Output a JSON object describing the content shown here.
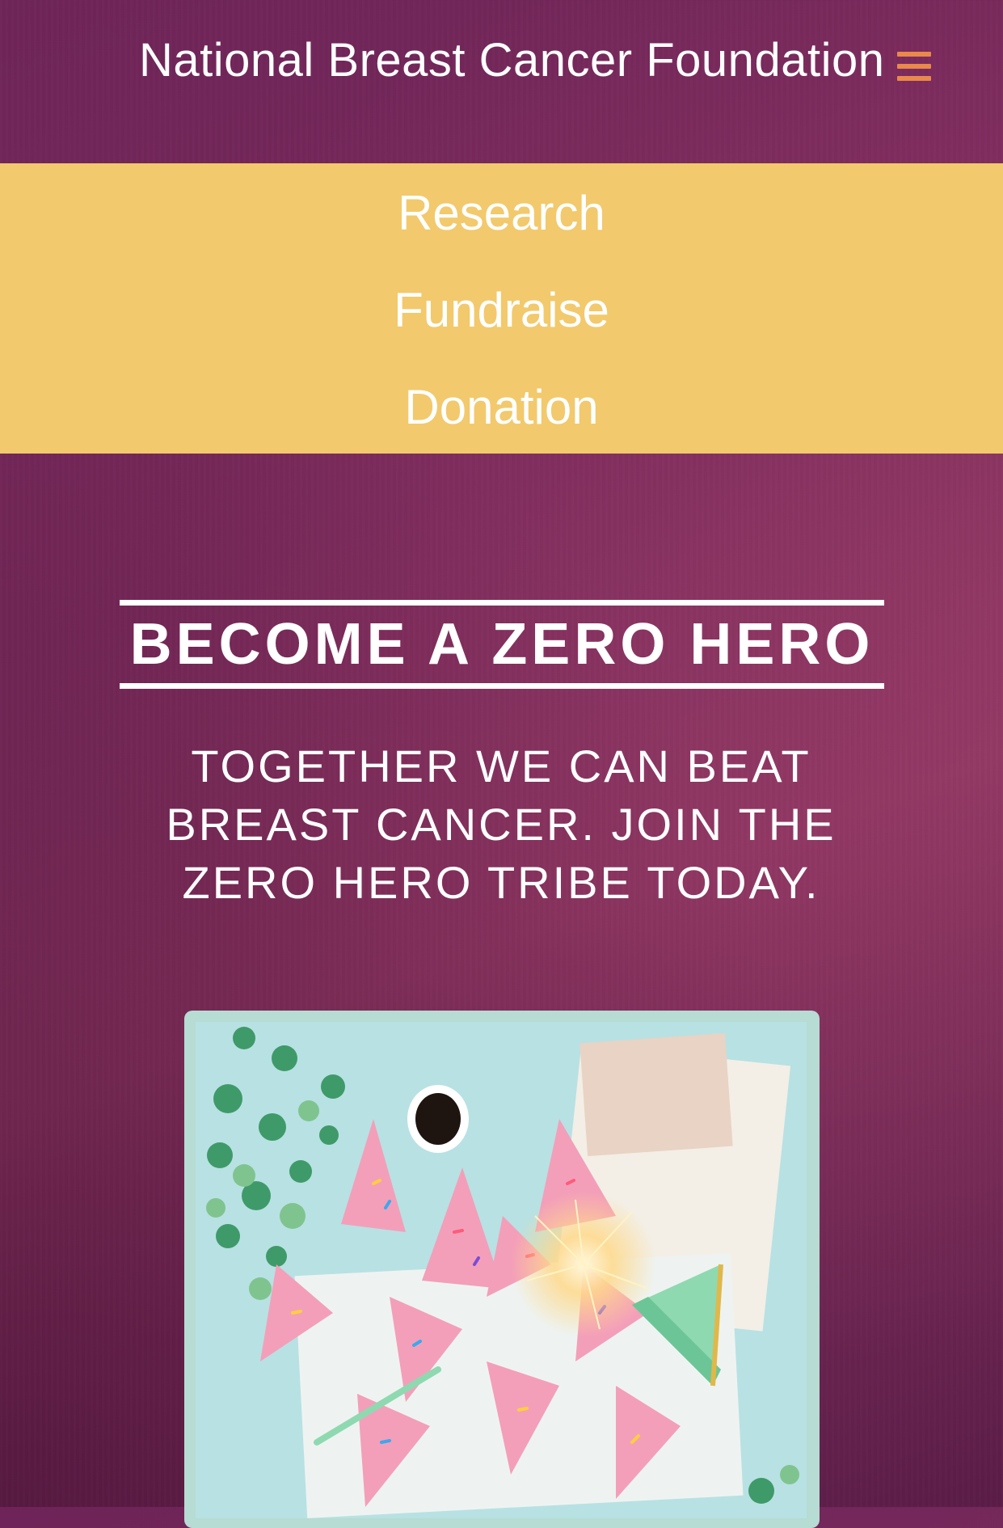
{
  "header": {
    "site_title": "National Breast Cancer Foundation",
    "menu_icon": "hamburger-menu-icon",
    "menu_icon_color": "#e9894a"
  },
  "nav": {
    "background_color": "#f2c96c",
    "items": [
      {
        "label": "Research"
      },
      {
        "label": "Fundraise"
      },
      {
        "label": "Donation"
      }
    ]
  },
  "hero": {
    "title": "BECOME A ZERO HERO",
    "subtitle": "TOGETHER WE CAN BEAT BREAST CANCER. JOIN THE ZERO HERO TRIBE TODAY."
  },
  "colors": {
    "page_background": "#7a2a5c",
    "frame": "#b6dcd3",
    "text": "#ffffff"
  }
}
